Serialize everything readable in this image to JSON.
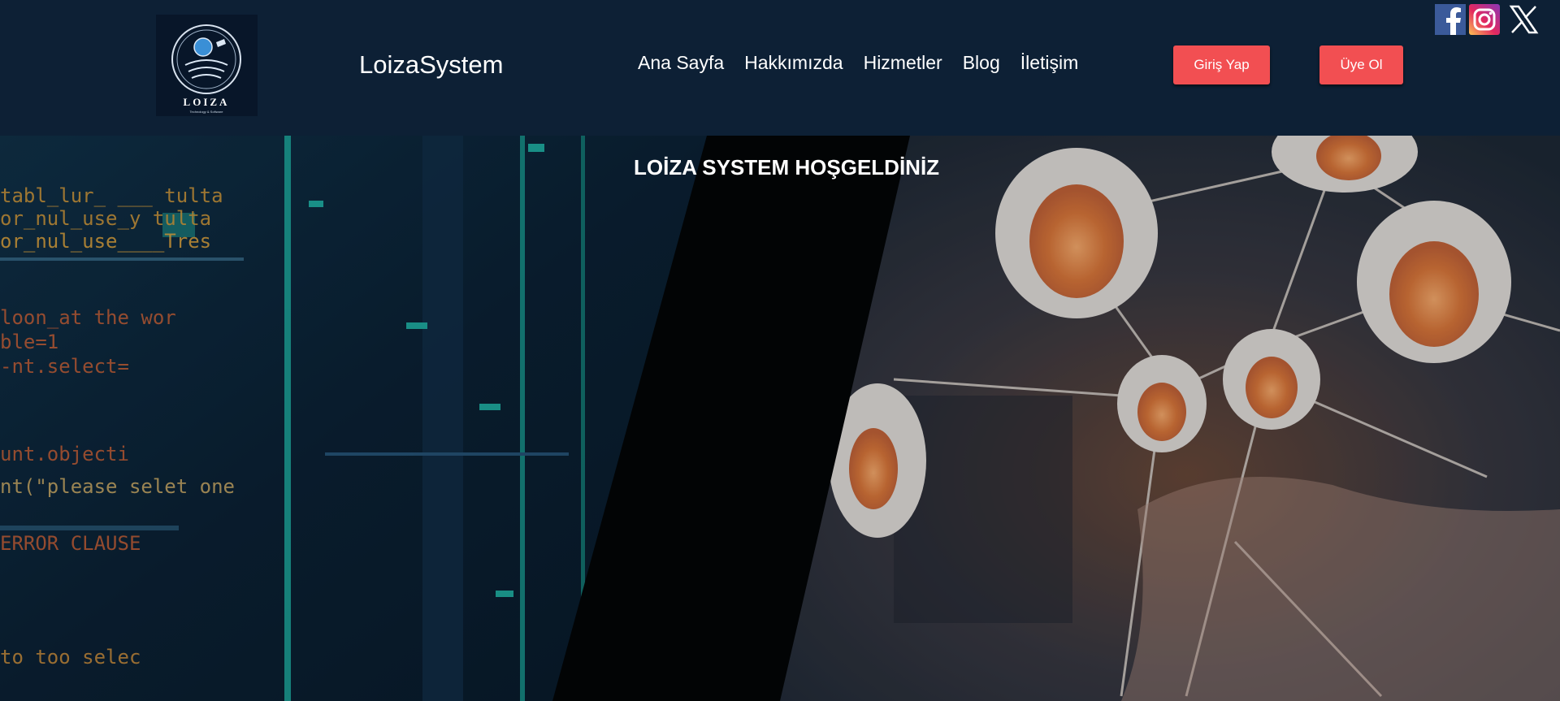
{
  "header": {
    "brand": "LoizaSystem",
    "logo": {
      "title": "LOIZA",
      "tagline": "Technology & Software"
    },
    "nav": [
      {
        "label": "Ana Sayfa"
      },
      {
        "label": "Hakkımızda"
      },
      {
        "label": "Hizmetler"
      },
      {
        "label": "Blog"
      },
      {
        "label": "İletişim"
      }
    ],
    "login_label": "Giriş Yap",
    "signup_label": "Üye Ol",
    "social": [
      {
        "icon": "facebook-icon"
      },
      {
        "icon": "instagram-icon"
      },
      {
        "icon": "x-icon"
      }
    ]
  },
  "hero": {
    "title": "LOİZA SYSTEM HOŞGELDİNİZ",
    "left_image_text": [
      "loon_at the wor",
      "ble=1",
      "-nt.select=",
      "unt.objecti",
      "nt(\"please selet one",
      "ERROR CLAUSE",
      "to too selec"
    ]
  },
  "colors": {
    "header_bg": "#0d2035",
    "button_bg": "#f24f52",
    "text": "#ffffff"
  }
}
